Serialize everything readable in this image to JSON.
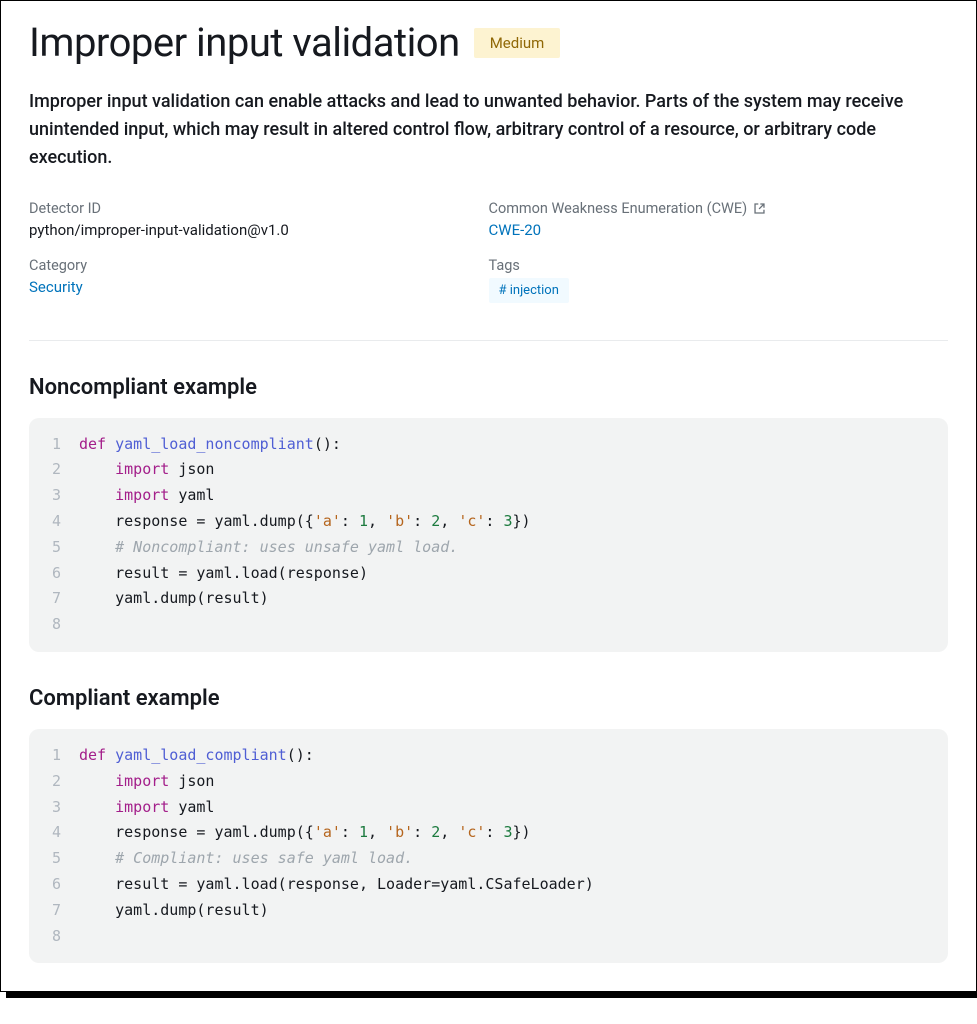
{
  "title": "Improper input validation",
  "severity": "Medium",
  "description": "Improper input validation can enable attacks and lead to unwanted behavior. Parts of the system may receive unintended input, which may result in altered control flow, arbitrary control of a resource, or arbitrary code execution.",
  "meta": {
    "detector_id_label": "Detector ID",
    "detector_id": "python/improper-input-validation@v1.0",
    "category_label": "Category",
    "category": "Security",
    "cwe_label": "Common Weakness Enumeration (CWE)",
    "cwe_link": "CWE-20",
    "tags_label": "Tags",
    "tag": "# injection"
  },
  "sections": {
    "noncompliant_title": "Noncompliant example",
    "compliant_title": "Compliant example"
  },
  "noncompliant_code": [
    {
      "n": "1",
      "tokens": [
        {
          "cls": "tok-kw",
          "t": "def "
        },
        {
          "cls": "tok-fn",
          "t": "yaml_load_noncompliant"
        },
        {
          "cls": "",
          "t": "():"
        }
      ]
    },
    {
      "n": "2",
      "tokens": [
        {
          "cls": "",
          "t": "    "
        },
        {
          "cls": "tok-kw",
          "t": "import"
        },
        {
          "cls": "",
          "t": " json"
        }
      ]
    },
    {
      "n": "3",
      "tokens": [
        {
          "cls": "",
          "t": "    "
        },
        {
          "cls": "tok-kw",
          "t": "import"
        },
        {
          "cls": "",
          "t": " yaml"
        }
      ]
    },
    {
      "n": "4",
      "tokens": [
        {
          "cls": "",
          "t": "    response = yaml.dump({"
        },
        {
          "cls": "tok-str",
          "t": "'a'"
        },
        {
          "cls": "",
          "t": ": "
        },
        {
          "cls": "tok-num",
          "t": "1"
        },
        {
          "cls": "",
          "t": ", "
        },
        {
          "cls": "tok-str",
          "t": "'b'"
        },
        {
          "cls": "",
          "t": ": "
        },
        {
          "cls": "tok-num",
          "t": "2"
        },
        {
          "cls": "",
          "t": ", "
        },
        {
          "cls": "tok-str",
          "t": "'c'"
        },
        {
          "cls": "",
          "t": ": "
        },
        {
          "cls": "tok-num",
          "t": "3"
        },
        {
          "cls": "",
          "t": "})"
        }
      ]
    },
    {
      "n": "5",
      "tokens": [
        {
          "cls": "",
          "t": "    "
        },
        {
          "cls": "tok-cm",
          "t": "# Noncompliant: uses unsafe yaml load."
        }
      ]
    },
    {
      "n": "6",
      "tokens": [
        {
          "cls": "",
          "t": "    result = yaml.load(response)"
        }
      ]
    },
    {
      "n": "7",
      "tokens": [
        {
          "cls": "",
          "t": "    yaml.dump(result)"
        }
      ]
    },
    {
      "n": "8",
      "tokens": [
        {
          "cls": "",
          "t": ""
        }
      ]
    }
  ],
  "compliant_code": [
    {
      "n": "1",
      "tokens": [
        {
          "cls": "tok-kw",
          "t": "def "
        },
        {
          "cls": "tok-fn",
          "t": "yaml_load_compliant"
        },
        {
          "cls": "",
          "t": "():"
        }
      ]
    },
    {
      "n": "2",
      "tokens": [
        {
          "cls": "",
          "t": "    "
        },
        {
          "cls": "tok-kw",
          "t": "import"
        },
        {
          "cls": "",
          "t": " json"
        }
      ]
    },
    {
      "n": "3",
      "tokens": [
        {
          "cls": "",
          "t": "    "
        },
        {
          "cls": "tok-kw",
          "t": "import"
        },
        {
          "cls": "",
          "t": " yaml"
        }
      ]
    },
    {
      "n": "4",
      "tokens": [
        {
          "cls": "",
          "t": "    response = yaml.dump({"
        },
        {
          "cls": "tok-str",
          "t": "'a'"
        },
        {
          "cls": "",
          "t": ": "
        },
        {
          "cls": "tok-num",
          "t": "1"
        },
        {
          "cls": "",
          "t": ", "
        },
        {
          "cls": "tok-str",
          "t": "'b'"
        },
        {
          "cls": "",
          "t": ": "
        },
        {
          "cls": "tok-num",
          "t": "2"
        },
        {
          "cls": "",
          "t": ", "
        },
        {
          "cls": "tok-str",
          "t": "'c'"
        },
        {
          "cls": "",
          "t": ": "
        },
        {
          "cls": "tok-num",
          "t": "3"
        },
        {
          "cls": "",
          "t": "})"
        }
      ]
    },
    {
      "n": "5",
      "tokens": [
        {
          "cls": "",
          "t": "    "
        },
        {
          "cls": "tok-cm",
          "t": "# Compliant: uses safe yaml load."
        }
      ]
    },
    {
      "n": "6",
      "tokens": [
        {
          "cls": "",
          "t": "    result = yaml.load(response, Loader=yaml.CSafeLoader)"
        }
      ]
    },
    {
      "n": "7",
      "tokens": [
        {
          "cls": "",
          "t": "    yaml.dump(result)"
        }
      ]
    },
    {
      "n": "8",
      "tokens": [
        {
          "cls": "",
          "t": ""
        }
      ]
    }
  ]
}
